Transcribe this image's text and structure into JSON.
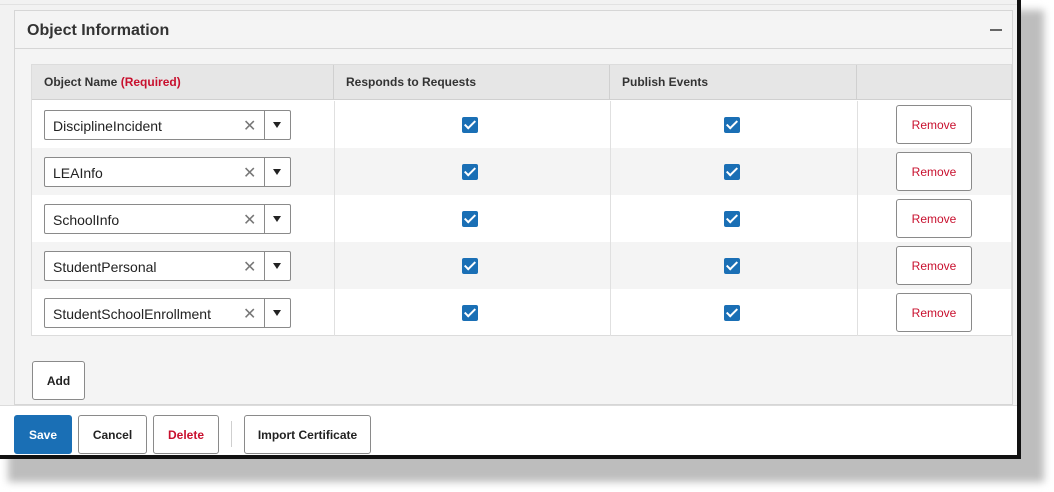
{
  "section": {
    "title": "Object Information",
    "collapse_icon": "minus-icon"
  },
  "table": {
    "columns": {
      "object_name": "Object Name",
      "object_name_required": "(Required)",
      "responds": "Responds to Requests",
      "publish": "Publish Events",
      "actions": ""
    },
    "rows": [
      {
        "object": "DisciplineIncident",
        "responds": true,
        "publish": true,
        "clear": "✕",
        "remove": "Remove"
      },
      {
        "object": "LEAInfo",
        "responds": true,
        "publish": true,
        "clear": "✕",
        "remove": "Remove"
      },
      {
        "object": "SchoolInfo",
        "responds": true,
        "publish": true,
        "clear": "✕",
        "remove": "Remove"
      },
      {
        "object": "StudentPersonal",
        "responds": true,
        "publish": true,
        "clear": "✕",
        "remove": "Remove"
      },
      {
        "object": "StudentSchoolEnrollment",
        "responds": true,
        "publish": true,
        "clear": "✕",
        "remove": "Remove"
      }
    ]
  },
  "add_label": "Add",
  "footer": {
    "save": "Save",
    "cancel": "Cancel",
    "delete": "Delete",
    "import": "Import Certificate"
  },
  "colors": {
    "primary": "#1a6fb5",
    "danger": "#c8102e"
  }
}
